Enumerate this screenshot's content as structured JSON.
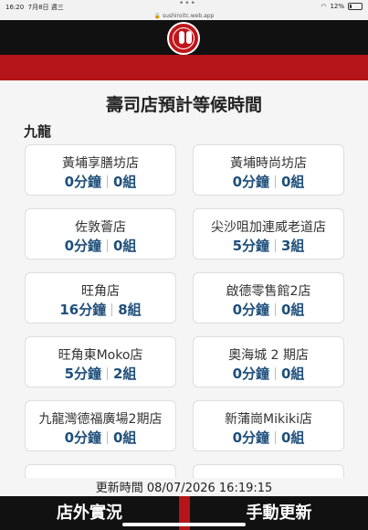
{
  "status_bar": {
    "time": "16:20",
    "date": "7月8日 週三",
    "dots": "•••",
    "battery": "12%"
  },
  "url": "sushiroitc.web.app",
  "page_title": "壽司店預計等候時間",
  "region": "九龍",
  "stores": [
    {
      "name": "黃埔享膳坊店",
      "minutes": "0分鐘",
      "groups": "0組"
    },
    {
      "name": "黃埔時尚坊店",
      "minutes": "0分鐘",
      "groups": "0組"
    },
    {
      "name": "佐敦薈店",
      "minutes": "0分鐘",
      "groups": "0組"
    },
    {
      "name": "尖沙咀加連威老道店",
      "minutes": "5分鐘",
      "groups": "3組"
    },
    {
      "name": "旺角店",
      "minutes": "16分鐘",
      "groups": "8組"
    },
    {
      "name": "啟德零售館2店",
      "minutes": "0分鐘",
      "groups": "0組"
    },
    {
      "name": "旺角東Moko店",
      "minutes": "5分鐘",
      "groups": "2組"
    },
    {
      "name": "奧海城 2 期店",
      "minutes": "0分鐘",
      "groups": "0組"
    },
    {
      "name": "九龍灣德福廣場2期店",
      "minutes": "0分鐘",
      "groups": "0組"
    },
    {
      "name": "新蒲崗Mikiki店",
      "minutes": "0分鐘",
      "groups": "0組"
    }
  ],
  "update": {
    "label": "更新時間",
    "value": "08/07/2026 16:19:15"
  },
  "bottom_nav": {
    "left": "店外實況",
    "right": "手動更新"
  },
  "colors": {
    "header_black": "#111111",
    "brand_red": "#b51419",
    "wait_blue": "#1f4f7a"
  }
}
